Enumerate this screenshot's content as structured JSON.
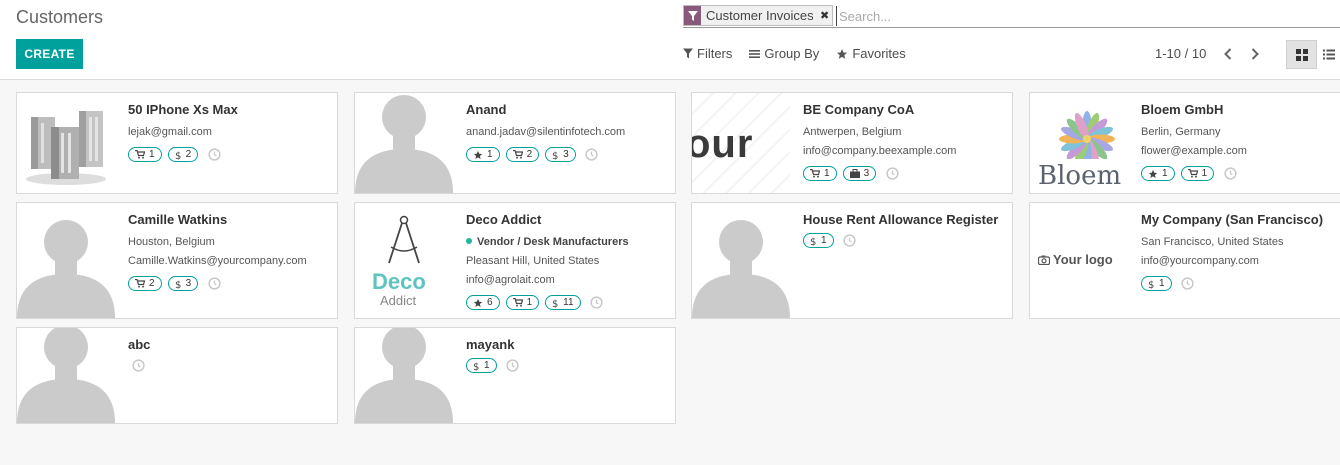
{
  "breadcrumb": "Customers",
  "create_label": "CREATE",
  "search": {
    "facet_label": "Customer Invoices",
    "facet_remove": "✖",
    "placeholder": "Search..."
  },
  "search_options": {
    "filters": "Filters",
    "group_by": "Group By",
    "favorites": "Favorites"
  },
  "pager": "1-10 / 10",
  "colors": {
    "accent": "#00a09d",
    "facet": "#875a7b",
    "vendor_dot": "#21b799"
  },
  "cards": [
    {
      "name": "50 IPhone Xs Max",
      "lines": [
        "lejak@gmail.com"
      ],
      "badges": [
        {
          "icon": "cart-icon",
          "value": "1"
        },
        {
          "icon": "dollar-icon",
          "value": "2"
        }
      ],
      "image": "office-building-image"
    },
    {
      "name": "Anand",
      "lines": [
        "anand.jadav@silentinfotech.com"
      ],
      "badges": [
        {
          "icon": "star-icon",
          "value": "1"
        },
        {
          "icon": "cart-icon",
          "value": "2"
        },
        {
          "icon": "dollar-icon",
          "value": "3"
        }
      ],
      "image": "person-placeholder"
    },
    {
      "name": "BE Company CoA",
      "lines": [
        "Antwerpen, Belgium",
        "info@company.beexample.com"
      ],
      "badges": [
        {
          "icon": "cart-icon",
          "value": "1"
        },
        {
          "icon": "briefcase-icon",
          "value": "3"
        }
      ],
      "image": "your-logo-partial",
      "image_text": "our"
    },
    {
      "name": "Bloem GmbH",
      "lines": [
        "Berlin, Germany",
        "flower@example.com"
      ],
      "badges": [
        {
          "icon": "star-icon",
          "value": "1"
        },
        {
          "icon": "cart-icon",
          "value": "1"
        }
      ],
      "image": "bloem-logo",
      "image_text": "Bloem"
    },
    {
      "name": "Camille Watkins",
      "lines": [
        "Houston, Belgium",
        "Camille.Watkins@yourcompany.com"
      ],
      "badges": [
        {
          "icon": "cart-icon",
          "value": "2"
        },
        {
          "icon": "dollar-icon",
          "value": "3"
        }
      ],
      "image": "person-placeholder"
    },
    {
      "name": "Deco Addict",
      "category": "Vendor / Desk Manufacturers",
      "lines": [
        "Pleasant Hill, United States",
        "info@agrolait.com"
      ],
      "badges": [
        {
          "icon": "star-icon",
          "value": "6"
        },
        {
          "icon": "cart-icon",
          "value": "1"
        },
        {
          "icon": "dollar-icon",
          "value": "11"
        }
      ],
      "image": "deco-addict-logo",
      "image_text": "Deco",
      "image_subtext": "Addict"
    },
    {
      "name": "House Rent Allowance Register",
      "lines": [],
      "badges": [
        {
          "icon": "dollar-icon",
          "value": "1"
        }
      ],
      "image": "person-placeholder"
    },
    {
      "name": "My Company (San Francisco)",
      "lines": [
        "San Francisco, United States",
        "info@yourcompany.com"
      ],
      "badges": [
        {
          "icon": "dollar-icon",
          "value": "1"
        }
      ],
      "image": "your-logo",
      "image_text": "Your logo"
    },
    {
      "name": "abc",
      "lines": [],
      "badges": [],
      "image": "person-placeholder"
    },
    {
      "name": "mayank",
      "lines": [],
      "badges": [
        {
          "icon": "dollar-icon",
          "value": "1"
        }
      ],
      "image": "person-placeholder"
    }
  ]
}
